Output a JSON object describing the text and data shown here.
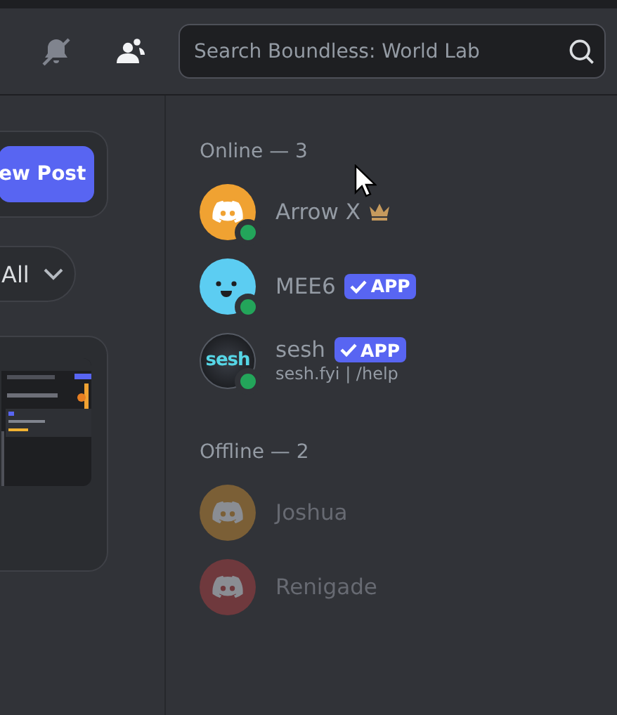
{
  "header": {
    "search": {
      "placeholder": "Search Boundless: World Lab"
    }
  },
  "left_panel": {
    "new_post_button": "ew Post",
    "filter": {
      "label": "All"
    }
  },
  "members": {
    "groups": [
      {
        "title": "Online — 3",
        "members": [
          {
            "name": "Arrow X",
            "online": true,
            "avatar": {
              "kind": "logo",
              "color": "#f0a232"
            },
            "badge": {
              "kind": "crown"
            }
          },
          {
            "name": "MEE6",
            "online": true,
            "avatar": {
              "kind": "face",
              "color": "#5ccdf2"
            },
            "badge": {
              "kind": "app",
              "label": "APP"
            }
          },
          {
            "name": "sesh",
            "online": true,
            "avatar": {
              "kind": "globe",
              "label": "sesh"
            },
            "badge": {
              "kind": "app",
              "label": "APP"
            },
            "subtitle": "sesh.fyi | /help"
          }
        ]
      },
      {
        "title": "Offline — 2",
        "members": [
          {
            "name": "Joshua",
            "online": false,
            "avatar": {
              "kind": "logo",
              "color": "#7b5f36"
            }
          },
          {
            "name": "Renigade",
            "online": false,
            "avatar": {
              "kind": "logo",
              "color": "#6f393d"
            }
          }
        ]
      }
    ]
  }
}
